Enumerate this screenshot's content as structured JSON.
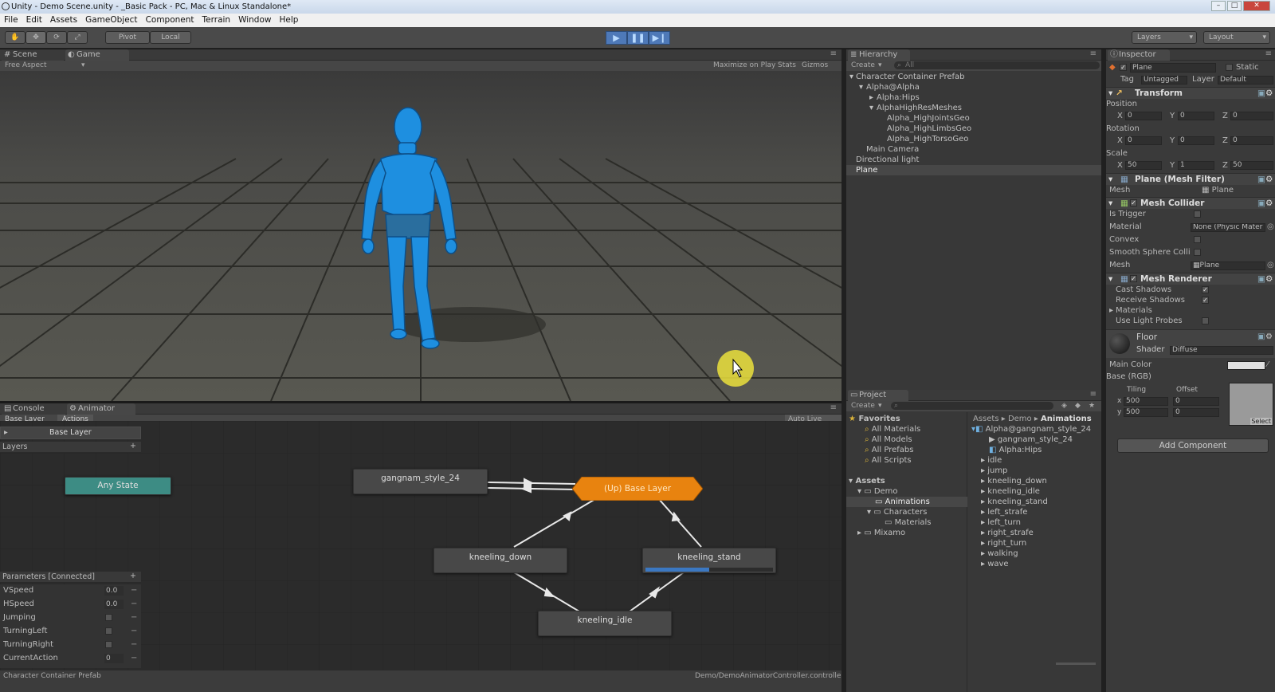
{
  "window": {
    "title": "Unity - Demo Scene.unity - _Basic Pack - PC, Mac & Linux Standalone*"
  },
  "menu": [
    "File",
    "Edit",
    "Assets",
    "GameObject",
    "Component",
    "Terrain",
    "Window",
    "Help"
  ],
  "toolbar": {
    "pivot": "Pivot",
    "local": "Local",
    "layers": "Layers",
    "layout": "Layout"
  },
  "scene_tabs": {
    "scene": "Scene",
    "game": "Game"
  },
  "game_bar": {
    "aspect": "Free Aspect",
    "maximize": "Maximize on Play",
    "stats": "Stats",
    "gizmos": "Gizmos"
  },
  "bottom_tabs": {
    "console": "Console",
    "animator": "Animator"
  },
  "animator": {
    "breadcrumb": [
      "Base Layer",
      "Actions"
    ],
    "live_link": "Auto Live Link",
    "layer_name": "Base Layer",
    "layers_label": "Layers",
    "params_label": "Parameters [Connected]",
    "parameters": [
      {
        "name": "VSpeed",
        "value": "0.0",
        "kind": "float"
      },
      {
        "name": "HSpeed",
        "value": "0.0",
        "kind": "float"
      },
      {
        "name": "Jumping",
        "value": "",
        "kind": "bool"
      },
      {
        "name": "TurningLeft",
        "value": "",
        "kind": "bool"
      },
      {
        "name": "TurningRight",
        "value": "",
        "kind": "bool"
      },
      {
        "name": "CurrentAction",
        "value": "0",
        "kind": "int"
      }
    ],
    "nodes": {
      "any_state": "Any State",
      "gangnam": "gangnam_style_24",
      "up_base": "(Up) Base Layer",
      "kneeling_down": "kneeling_down",
      "kneeling_stand": "kneeling_stand",
      "kneeling_idle": "kneeling_idle"
    },
    "kneeling_stand_progress": 0.5
  },
  "statusbar": {
    "left": "Character Container Prefab",
    "right": "Demo/DemoAnimatorController.controller"
  },
  "hierarchy": {
    "tab": "Hierarchy",
    "create": "Create",
    "search": "All",
    "items": [
      {
        "label": "Character Container Prefab",
        "indent": 0,
        "arrow": "down"
      },
      {
        "label": "Alpha@Alpha",
        "indent": 1,
        "arrow": "down"
      },
      {
        "label": "Alpha:Hips",
        "indent": 2,
        "arrow": "right"
      },
      {
        "label": "AlphaHighResMeshes",
        "indent": 2,
        "arrow": "down"
      },
      {
        "label": "Alpha_HighJointsGeo",
        "indent": 3,
        "arrow": ""
      },
      {
        "label": "Alpha_HighLimbsGeo",
        "indent": 3,
        "arrow": ""
      },
      {
        "label": "Alpha_HighTorsoGeo",
        "indent": 3,
        "arrow": ""
      },
      {
        "label": "Main Camera",
        "indent": 1,
        "arrow": ""
      },
      {
        "label": "Directional light",
        "indent": 0,
        "arrow": ""
      },
      {
        "label": "Plane",
        "indent": 0,
        "arrow": ""
      }
    ]
  },
  "project": {
    "tab": "Project",
    "create": "Create",
    "favorites_label": "Favorites",
    "favorites": [
      "All Materials",
      "All Models",
      "All Prefabs",
      "All Scripts"
    ],
    "assets_label": "Assets",
    "tree": [
      {
        "label": "Demo",
        "indent": 1
      },
      {
        "label": "Animations",
        "indent": 2
      },
      {
        "label": "Characters",
        "indent": 2
      },
      {
        "label": "Materials",
        "indent": 3
      },
      {
        "label": "Mixamo",
        "indent": 1
      }
    ],
    "breadcrumb": [
      "Assets",
      "Demo",
      "Animations"
    ],
    "files": [
      {
        "label": "Alpha@gangnam_style_24",
        "indent": 0
      },
      {
        "label": "gangnam_style_24",
        "indent": 1
      },
      {
        "label": "Alpha:Hips",
        "indent": 1
      },
      {
        "label": "idle",
        "indent": 0
      },
      {
        "label": "jump",
        "indent": 0
      },
      {
        "label": "kneeling_down",
        "indent": 0
      },
      {
        "label": "kneeling_idle",
        "indent": 0
      },
      {
        "label": "kneeling_stand",
        "indent": 0
      },
      {
        "label": "left_strafe",
        "indent": 0
      },
      {
        "label": "left_turn",
        "indent": 0
      },
      {
        "label": "right_strafe",
        "indent": 0
      },
      {
        "label": "right_turn",
        "indent": 0
      },
      {
        "label": "walking",
        "indent": 0
      },
      {
        "label": "wave",
        "indent": 0
      }
    ]
  },
  "inspector": {
    "tab": "Inspector",
    "object_name": "Plane",
    "static": "Static",
    "tag_label": "Tag",
    "tag_value": "Untagged",
    "layer_label": "Layer",
    "layer_value": "Default",
    "transform": "Transform",
    "position": "Position",
    "rotation": "Rotation",
    "scale": "Scale",
    "pos": [
      "0",
      "0",
      "0"
    ],
    "rot": [
      "0",
      "0",
      "0"
    ],
    "scl": [
      "50",
      "1",
      "50"
    ],
    "mesh_filter": "Plane (Mesh Filter)",
    "mesh_label": "Mesh",
    "mesh_value": "Plane",
    "mesh_collider": "Mesh Collider",
    "is_trigger": "Is Trigger",
    "material_label": "Material",
    "material_value": "None (Physic Mater",
    "convex": "Convex",
    "smooth": "Smooth Sphere Colli",
    "mesh_renderer": "Mesh Renderer",
    "cast_shadows": "Cast Shadows",
    "receive_shadows": "Receive Shadows",
    "materials": "Materials",
    "use_light_probes": "Use Light Probes",
    "floor": "Floor",
    "shader_label": "Shader",
    "shader_value": "Diffuse",
    "main_color": "Main Color",
    "base_rgb": "Base (RGB)",
    "tiling": "Tiling",
    "offset": "Offset",
    "tiling_x": "500",
    "tiling_y": "500",
    "offset_x": "0",
    "offset_y": "0",
    "select": "Select",
    "add_component": "Add Component"
  },
  "colors": {
    "accent": "#4e79b8",
    "orange_node": "#e8830f",
    "teal_node": "#3d8c84",
    "progress": "#3b78c2"
  }
}
